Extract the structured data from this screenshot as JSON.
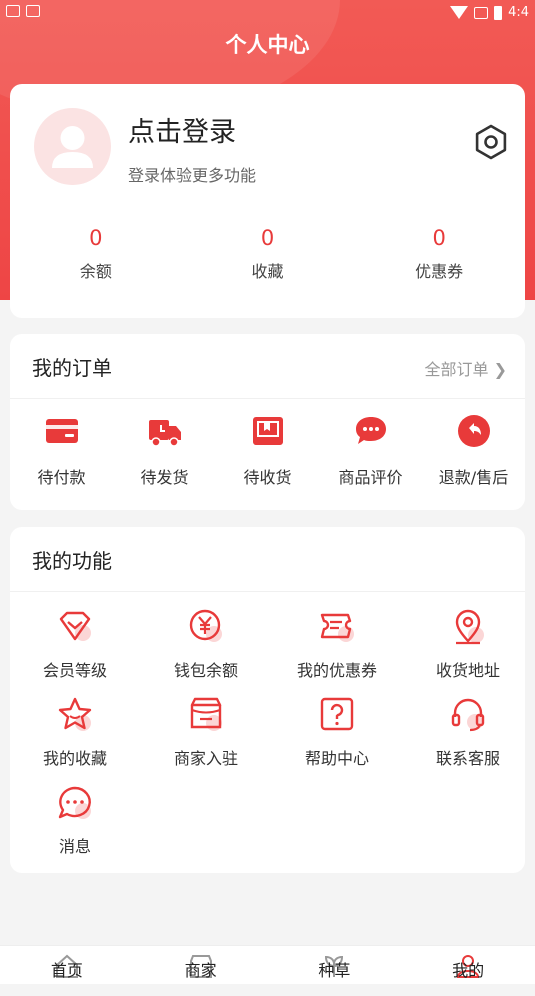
{
  "status_bar": {
    "time": "4:4"
  },
  "header": {
    "title": "个人中心"
  },
  "profile": {
    "login_title": "点击登录",
    "login_subtitle": "登录体验更多功能",
    "stats": [
      {
        "value": "0",
        "label": "余额"
      },
      {
        "value": "0",
        "label": "收藏"
      },
      {
        "value": "0",
        "label": "优惠券"
      }
    ]
  },
  "orders": {
    "title": "我的订单",
    "all_link": "全部订单",
    "items": [
      {
        "label": "待付款",
        "icon": "wallet-icon"
      },
      {
        "label": "待发货",
        "icon": "truck-icon"
      },
      {
        "label": "待收货",
        "icon": "package-icon"
      },
      {
        "label": "商品评价",
        "icon": "comment-icon"
      },
      {
        "label": "退款/售后",
        "icon": "return-icon"
      }
    ]
  },
  "functions": {
    "title": "我的功能",
    "items": [
      {
        "label": "会员等级",
        "icon": "diamond-icon"
      },
      {
        "label": "钱包余额",
        "icon": "yen-icon"
      },
      {
        "label": "我的优惠券",
        "icon": "coupon-icon"
      },
      {
        "label": "收货地址",
        "icon": "location-icon"
      },
      {
        "label": "我的收藏",
        "icon": "star-icon"
      },
      {
        "label": "商家入驻",
        "icon": "store-icon"
      },
      {
        "label": "帮助中心",
        "icon": "help-icon"
      },
      {
        "label": "联系客服",
        "icon": "headset-icon"
      },
      {
        "label": "消息",
        "icon": "message-icon"
      }
    ]
  },
  "tabbar": {
    "items": [
      {
        "label": "首页",
        "active": false
      },
      {
        "label": "商家",
        "active": false
      },
      {
        "label": "种草",
        "active": false
      },
      {
        "label": "我的",
        "active": true
      }
    ]
  },
  "colors": {
    "accent": "#e83a3a",
    "header": "#ef4a47",
    "avatar_bg": "#fbe3e3"
  }
}
